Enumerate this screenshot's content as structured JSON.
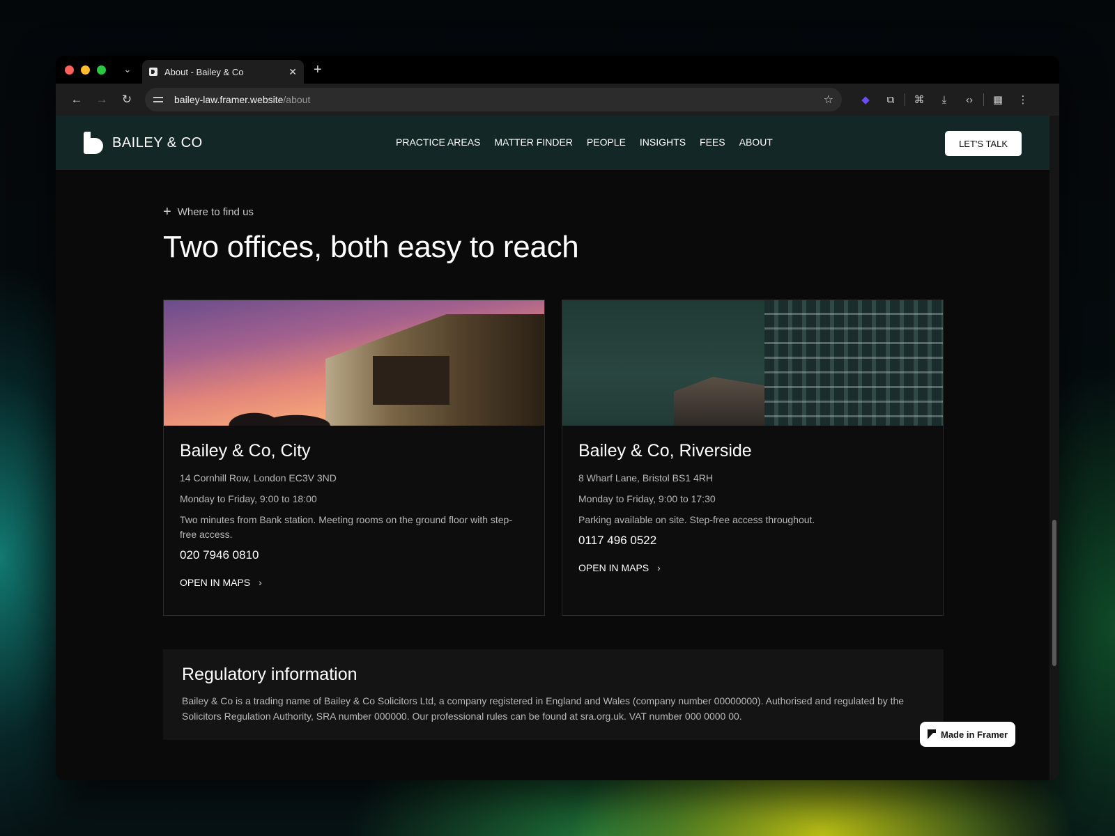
{
  "browser": {
    "tab_title": "About - Bailey & Co",
    "tab_close": "✕",
    "new_tab": "+",
    "url_host": "bailey-law.framer.website",
    "url_path": "/about"
  },
  "site": {
    "logo_text": "BAILEY & CO",
    "nav": [
      "PRACTICE AREAS",
      "MATTER FINDER",
      "PEOPLE",
      "INSIGHTS",
      "FEES",
      "ABOUT"
    ],
    "cta": "LET'S TALK"
  },
  "section": {
    "eyebrow": "Where to find us",
    "headline": "Two offices, both easy to reach"
  },
  "offices": [
    {
      "name": "Bailey & Co, City",
      "address": "14 Cornhill Row, London EC3V 3ND",
      "hours": "Monday to Friday, 9:00 to 18:00",
      "notes": "Two minutes from Bank station. Meeting rooms on the ground floor with step-free access.",
      "phone": "020 7946 0810",
      "link": "OPEN IN MAPS"
    },
    {
      "name": "Bailey & Co, Riverside",
      "address": "8 Wharf Lane, Bristol BS1 4RH",
      "hours": "Monday to Friday, 9:00 to 17:30",
      "notes": "Parking available on site. Step-free access throughout.",
      "phone": "0117 496 0522",
      "link": "OPEN IN MAPS"
    }
  ],
  "regulatory": {
    "title": "Regulatory information",
    "text": "Bailey & Co is a trading name of Bailey & Co Solicitors Ltd, a company registered in England and Wales (company number 00000000). Authorised and regulated by the Solicitors Regulation Authority, SRA number 000000. Our professional rules can be found at sra.org.uk. VAT number 000 0000 00."
  },
  "badge": "Made in Framer",
  "colors": {
    "header_bg": "#132826",
    "page_bg": "#0a0a0a"
  },
  "icons": {
    "back": "back-arrow-icon",
    "forward": "forward-arrow-icon",
    "reload": "reload-icon",
    "bookmark": "star-icon",
    "extension": "puzzle-icon",
    "translate": "translate-icon",
    "download": "download-icon",
    "devtools": "code-icon",
    "menu": "kebab-menu-icon"
  }
}
